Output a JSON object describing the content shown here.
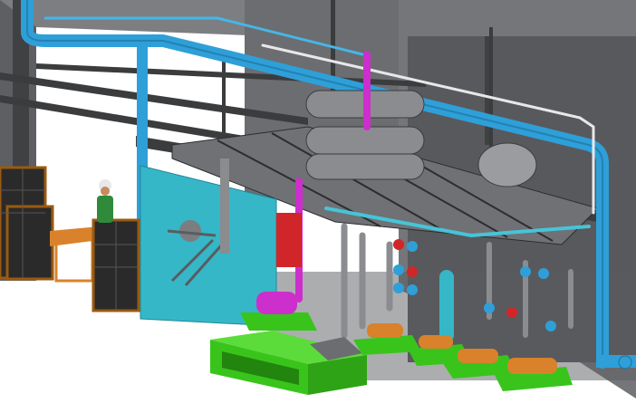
{
  "scene": {
    "kind": "3D plant layout render",
    "colors": {
      "background": "#ffffff",
      "structure": "#6b6d70",
      "structure_dark": "#4a4b4d",
      "steel": "#3b3c3e",
      "main_pipe": "#2f9fd8",
      "panel": "#35b7c7",
      "magenta": "#cc2fcc",
      "red": "#d0262a",
      "pump_orange": "#d9822b",
      "base_green": "#39c41c",
      "vessel": "#8a8c90",
      "cage": "#9a5a10",
      "worker_shirt": "#2f8a3a"
    },
    "items": [
      "main-pipe",
      "control-panel",
      "pump-skids",
      "green-base-block",
      "pressure-vessels",
      "storage-cages",
      "worker"
    ]
  }
}
